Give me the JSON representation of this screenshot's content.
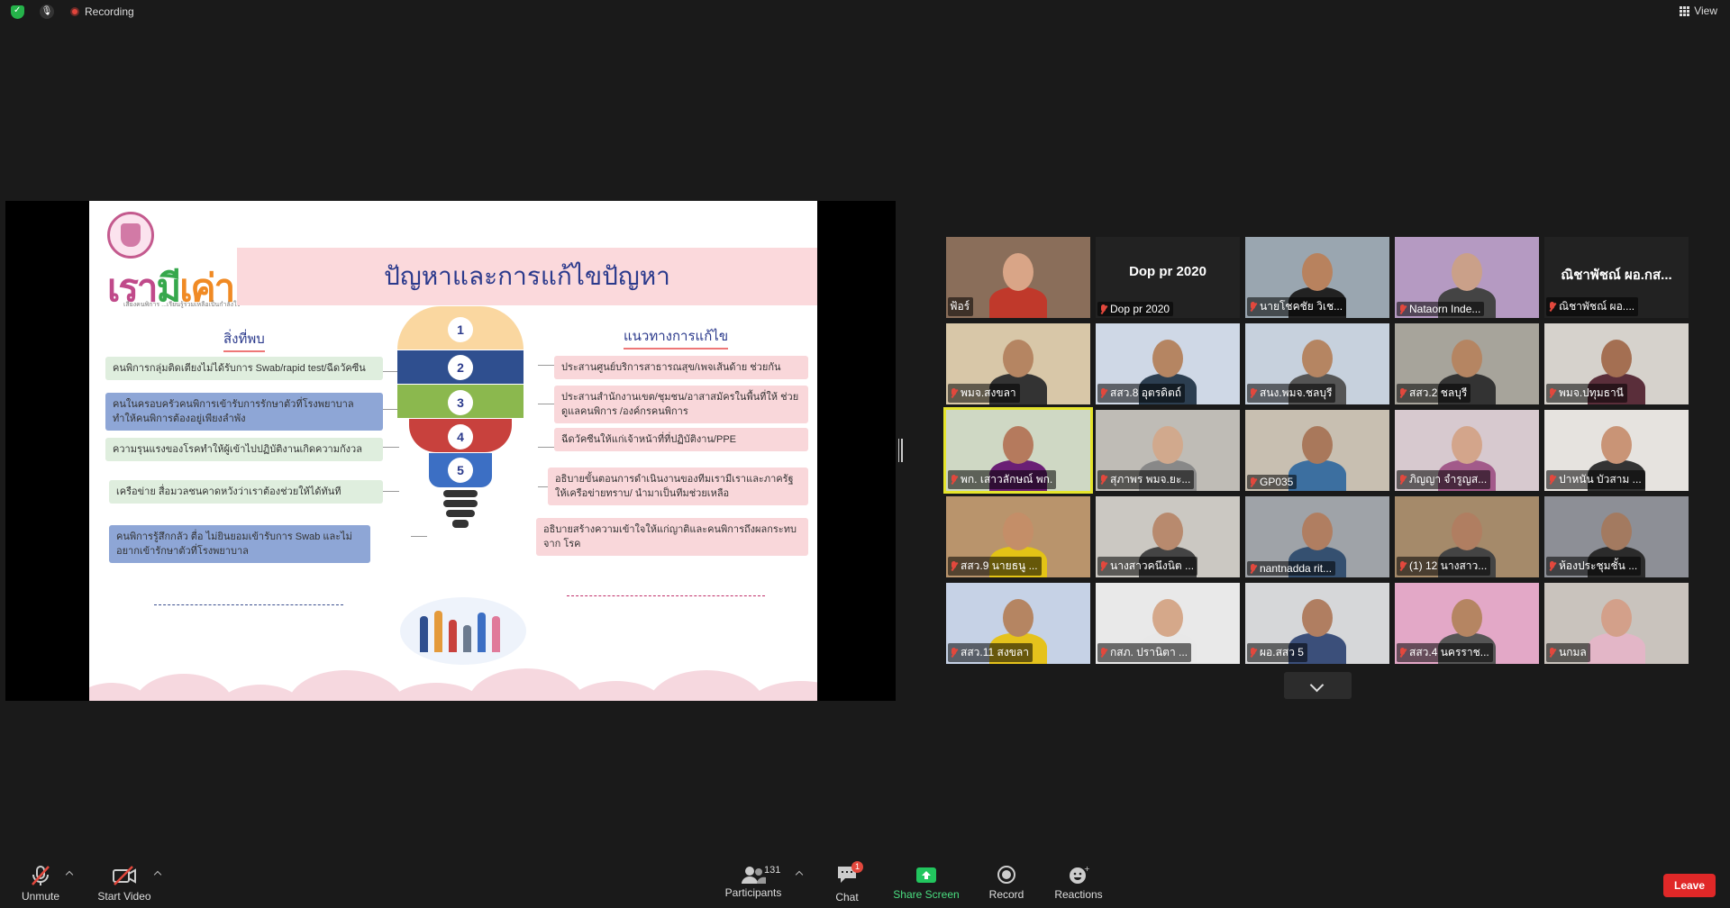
{
  "topbar": {
    "recording_label": "Recording",
    "view_label": "View"
  },
  "slide": {
    "title": "ปัญหาและการแก้ไขปัญหา",
    "logo_text_1": "เรา",
    "logo_text_2": "มี",
    "logo_text_3": "เค่า",
    "logo_sub": "เสียงคนพิการ ...เรียนรู้ร่วมเหลือเป็นกำลังใจ",
    "found_heading": "สิ่งที่พบ",
    "solution_heading": "แนวทางการแก้ไข",
    "found": [
      "คนพิการกลุ่มติดเตียงไม่ได้รับการ Swab/rapid test/ฉีดวัคซีน",
      "คนในครอบครัวคนพิการเข้ารับการรักษาตัวที่โรงพยาบาล ทำให้คนพิการต้องอยู่เพียงลำพัง",
      "ความรุนแรงของโรคทำให้ผู้เข้าไปปฏิบัติงานเกิดความกังวล",
      "เครือข่าย สื่อมวลชนคาดหวังว่าเราต้องช่วยให้ได้ทันที",
      "คนพิการรู้สึกกลัว ตื่อ ไม่ยินยอมเข้ารับการ Swab และไม่อยากเข้ารักษาตัวที่โรงพยาบาล"
    ],
    "solutions": [
      "ประสานศูนย์บริการสาธารณสุข/เพจเส้นด้าย ช่วยกัน",
      "ประสานสำนักงานเขต/ชุมชน/อาสาสมัครในพื้นที่ให้ ช่วยดูแลคนพิการ /องค์กรคนพิการ",
      "ฉีดวัคซีนให้แก่เจ้าหน้าที่ที่ปฏิบัติงาน/PPE",
      "อธิบายขั้นตอนการดำเนินงานของทีมเรามีเราและภาครัฐ ให้เครือข่ายทราบ/ นำมาเป็นทีมช่วยเหลือ",
      "อธิบายสร้างความเข้าใจให้แก่ญาติและคนพิการถึงผลกระทบจาก โรค"
    ],
    "bulb_numbers": [
      "1",
      "2",
      "3",
      "4",
      "5"
    ],
    "colors": {
      "title_band": "#fbd9dc",
      "seg1": "#fad7a0",
      "seg2": "#2f4f8f",
      "seg3": "#8bb84e",
      "seg4": "#c8413d",
      "seg5": "#3c6fc4"
    }
  },
  "gallery": [
    {
      "name": "ฟ้อร์",
      "muted": false,
      "bg": "#8a6e5a",
      "skin": "#d9a587",
      "shirt": "#c0392b"
    },
    {
      "name": "Dop pr 2020",
      "muted": true,
      "video": false,
      "bg": "#222222"
    },
    {
      "name": "นายโชคชัย วิเช...",
      "muted": true,
      "bg": "#9aa6b0",
      "skin": "#b8825e",
      "shirt": "#222"
    },
    {
      "name": "Nataorn Inde...",
      "muted": true,
      "bg": "#b59ac2",
      "skin": "#caa089",
      "shirt": "#444"
    },
    {
      "name": "ณิชาพัชณ์ ผอ....",
      "muted": true,
      "video": false,
      "bg": "#222222",
      "display": "ณิชาพัชณ์ ผอ.กส..."
    },
    {
      "name": "พมจ.สงขลา",
      "muted": true,
      "bg": "#d8c7a8",
      "skin": "#b58562",
      "shirt": "#333"
    },
    {
      "name": "สสว.8 อุตรดิตถ์",
      "muted": true,
      "bg": "#cfd8e6",
      "skin": "#b58562",
      "shirt": "#2c3e50"
    },
    {
      "name": "สนง.พมจ.ชลบุรี",
      "muted": true,
      "bg": "#c7d1dd",
      "skin": "#b58562",
      "shirt": "#555"
    },
    {
      "name": "สสว.2 ชลบุรี",
      "muted": true,
      "bg": "#a7a49b",
      "skin": "#b58562",
      "shirt": "#333"
    },
    {
      "name": "พมจ.ปทุมธานี",
      "muted": true,
      "bg": "#d6d2cc",
      "skin": "#a46f52",
      "shirt": "#5a2e3a"
    },
    {
      "name": "พก. เสาวลักษณ์ พก.",
      "muted": true,
      "bg": "#cfd8c4",
      "skin": "#b57a5d",
      "shirt": "#6a1f75",
      "active": true
    },
    {
      "name": "สุภาพร พมจ.ยะ...",
      "muted": true,
      "bg": "#bfbcb6",
      "skin": "#d1a98d",
      "shirt": "#888"
    },
    {
      "name": "GP035",
      "muted": true,
      "bg": "#c8bfb1",
      "skin": "#a9785b",
      "shirt": "#3c6fa0"
    },
    {
      "name": "ภิญญา จำรูญส...",
      "muted": true,
      "bg": "#d7c9cf",
      "skin": "#d3a58b",
      "shirt": "#a25a8a"
    },
    {
      "name": "ปาหนัน บัวสาม ...",
      "muted": true,
      "bg": "#e6e3df",
      "skin": "#c99476",
      "shirt": "#333"
    },
    {
      "name": "สสว.9 นายธนู ...",
      "muted": true,
      "bg": "#b9946c",
      "skin": "#c48e68",
      "shirt": "#e3c316"
    },
    {
      "name": "นางสาวคนึงนิต ...",
      "muted": true,
      "bg": "#cbc8c2",
      "skin": "#b88a6e",
      "shirt": "#444"
    },
    {
      "name": "nantnadda rit...",
      "muted": true,
      "bg": "#9fa3a8",
      "skin": "#b07e61",
      "shirt": "#355070"
    },
    {
      "name": "(1) 12 นางสาว...",
      "muted": true,
      "bg": "#a58a6a",
      "skin": "#b07e61",
      "shirt": "#444"
    },
    {
      "name": "ห้องประชุมชั้น ...",
      "muted": true,
      "bg": "#8d8f96",
      "skin": "#a37a60",
      "shirt": "#2b2b2b"
    },
    {
      "name": "สสว.11 สงขลา",
      "muted": true,
      "bg": "#c6d2e6",
      "skin": "#b58562",
      "shirt": "#e5c21c"
    },
    {
      "name": "กสภ. ปรานิตา ...",
      "muted": true,
      "bg": "#e9e9e9",
      "skin": "#d5a88a",
      "shirt": "#e8e8e8"
    },
    {
      "name": "ผอ.สสว 5",
      "muted": true,
      "bg": "#d6d7d9",
      "skin": "#b07e61",
      "shirt": "#3b4f7a"
    },
    {
      "name": "สสว.4 นครราช...",
      "muted": true,
      "bg": "#e3a8c7",
      "skin": "#b58562",
      "shirt": "#555"
    },
    {
      "name": "นกมล",
      "muted": true,
      "bg": "#c9c3bd",
      "skin": "#d3a08a",
      "shirt": "#e3b6c7"
    }
  ],
  "toolbar": {
    "unmute_label": "Unmute",
    "start_video_label": "Start Video",
    "participants_label": "Participants",
    "participants_count": "131",
    "chat_label": "Chat",
    "chat_badge": "1",
    "share_label": "Share Screen",
    "record_label": "Record",
    "reactions_label": "Reactions",
    "leave_label": "Leave",
    "share_color": "#22c55e"
  }
}
